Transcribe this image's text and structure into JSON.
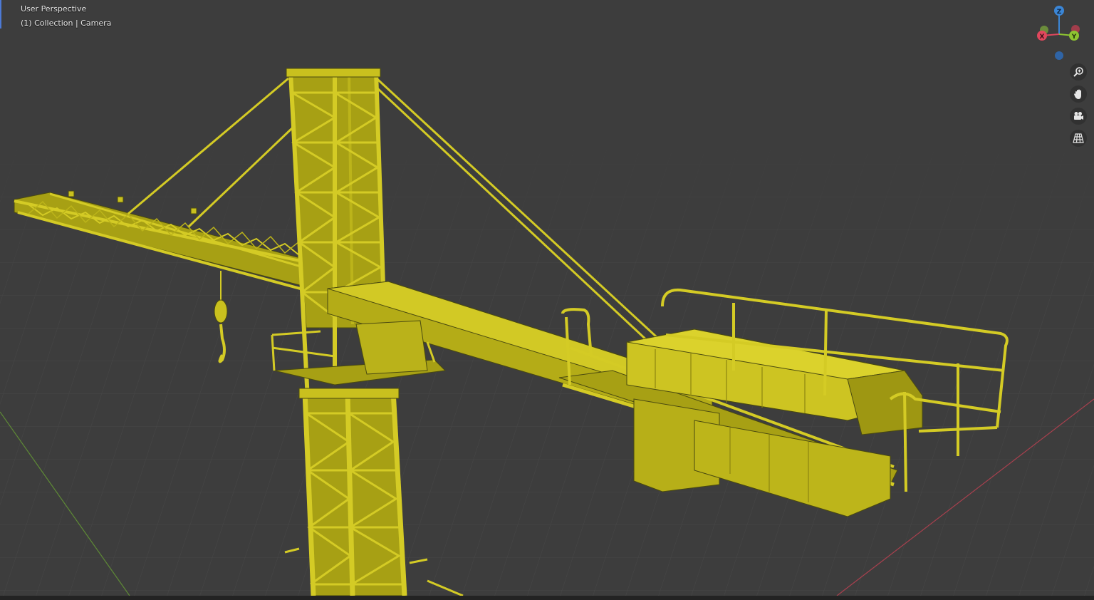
{
  "viewport": {
    "title": "User Perspective",
    "collection": "(1) Collection | Camera",
    "object_color": "#c9c01e",
    "background_color": "#3d3d3d"
  },
  "gizmo": {
    "z_label": "Z",
    "y_label": "Y",
    "x_label": "X",
    "x_color": "#e0475d",
    "y_color": "#8ec531",
    "z_color": "#3b86d6"
  },
  "nav_tools": [
    {
      "name": "zoom-icon"
    },
    {
      "name": "pan-hand-icon"
    },
    {
      "name": "camera-view-icon"
    },
    {
      "name": "orthographic-grid-icon"
    }
  ]
}
